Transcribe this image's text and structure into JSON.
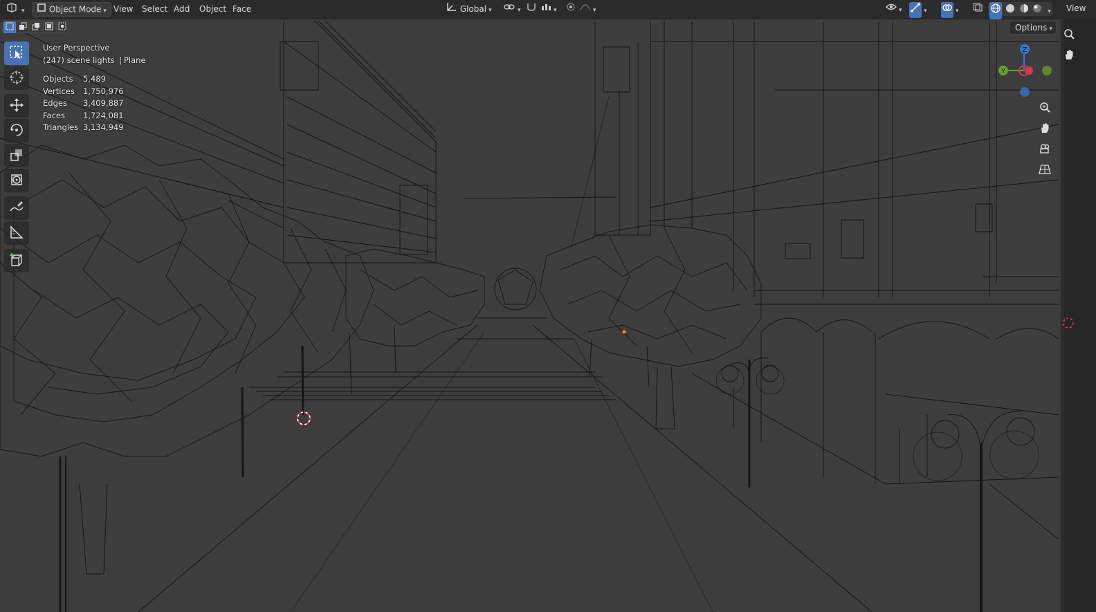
{
  "header": {
    "editor_type_icon": "editor-type-icon",
    "mode": "Object Mode",
    "menus": [
      "View",
      "Select",
      "Add",
      "Object",
      "Face"
    ],
    "orientation": "Global",
    "right_tab": "View"
  },
  "toolbar": {
    "tools": [
      "select-box-icon",
      "cursor-icon",
      "move-icon",
      "rotate-icon",
      "scale-icon",
      "transform-icon",
      "annotate-icon",
      "measure-icon",
      "add-cube-icon"
    ],
    "active_tool": "select-box-icon",
    "options_label": "Options"
  },
  "viewport": {
    "view_name": "User Perspective",
    "collection": "(247) scene lights",
    "active_object": "Plane",
    "stats": [
      {
        "label": "Objects",
        "value": "5,489"
      },
      {
        "label": "Vertices",
        "value": "1,750,976"
      },
      {
        "label": "Edges",
        "value": "3,409,887"
      },
      {
        "label": "Faces",
        "value": "1,724,081"
      },
      {
        "label": "Triangles",
        "value": "3,134,949"
      }
    ],
    "shading": "wireframe",
    "colors": {
      "background": "#3d3d3d",
      "wire": "#111111",
      "accent": "#4772b3"
    }
  },
  "gizmo": {
    "axes": [
      "X",
      "Y",
      "Z"
    ],
    "colors": {
      "x": "#d63a4a",
      "y": "#6aa22a",
      "z": "#2f79d2"
    }
  }
}
